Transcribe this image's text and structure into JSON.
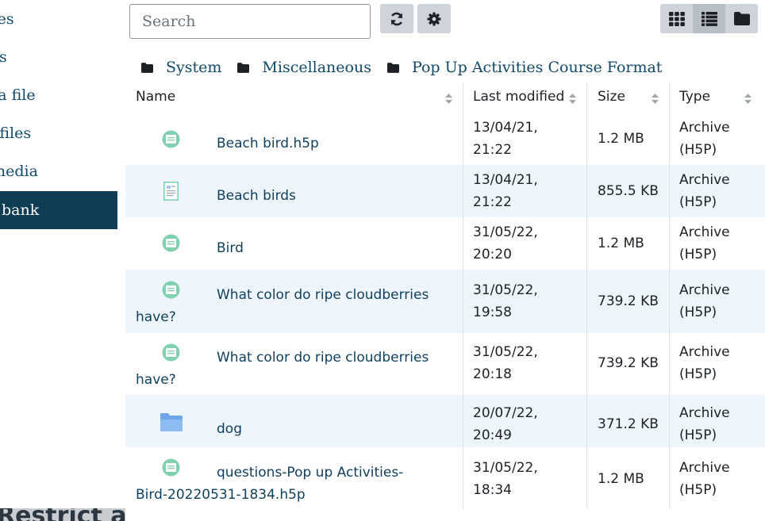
{
  "sidebar": {
    "items": [
      {
        "label": "Private files",
        "active": false
      },
      {
        "label": "Content files",
        "active": false
      },
      {
        "label": "Upload a file",
        "active": false
      },
      {
        "label": "Course files",
        "active": false
      },
      {
        "label": "Embedded media",
        "active": false
      },
      {
        "label": "Content bank",
        "active": true
      }
    ],
    "bottom_text": "Restrict ac"
  },
  "toolbar": {
    "search_placeholder": "Search",
    "refresh_icon": "refresh-icon",
    "settings_icon": "gear-icon",
    "view_icons": [
      "grid-icon",
      "list-icon",
      "folder-tree-icon"
    ],
    "active_view": "list"
  },
  "breadcrumb": [
    "System",
    "Miscellaneous",
    "Pop Up Activities Course Format"
  ],
  "table": {
    "columns": [
      "Name",
      "Last modified",
      "Size",
      "Type"
    ],
    "rows": [
      {
        "name_line1": "Beach bird.h5p",
        "name_line2": "",
        "date1": "13/04/21,",
        "date2": "21:22",
        "size": "1.2 MB",
        "type1": "Archive",
        "type2": "(H5P)",
        "icon": "h5p-file-icon"
      },
      {
        "name_line1": "Beach birds",
        "name_line2": "",
        "date1": "13/04/21,",
        "date2": "21:22",
        "size": "855.5 KB",
        "type1": "Archive",
        "type2": "(H5P)",
        "icon": "document-icon"
      },
      {
        "name_line1": "Bird",
        "name_line2": "",
        "date1": "31/05/22,",
        "date2": "20:20",
        "size": "1.2 MB",
        "type1": "Archive",
        "type2": "(H5P)",
        "icon": "h5p-file-icon"
      },
      {
        "name_line1": "What color do ripe cloudberries",
        "name_line2": "have?",
        "date1": "31/05/22,",
        "date2": "19:58",
        "size": "739.2 KB",
        "type1": "Archive",
        "type2": "(H5P)",
        "icon": "h5p-file-icon"
      },
      {
        "name_line1": "What color do ripe cloudberries",
        "name_line2": "have?",
        "date1": "31/05/22,",
        "date2": "20:18",
        "size": "739.2 KB",
        "type1": "Archive",
        "type2": "(H5P)",
        "icon": "h5p-file-icon"
      },
      {
        "name_line1": "dog",
        "name_line2": "",
        "date1": "20/07/22,",
        "date2": "20:49",
        "size": "371.2 KB",
        "type1": "Archive",
        "type2": "(H5P)",
        "icon": "folder-icon"
      },
      {
        "name_line1": "questions-Pop up Activities-",
        "name_line2": "Bird-20220531-1834.h5p",
        "date1": "31/05/22,",
        "date2": "18:34",
        "size": "1.2 MB",
        "type1": "Archive",
        "type2": "(H5P)",
        "icon": "h5p-file-icon"
      }
    ]
  },
  "colors": {
    "active_sidebar_bg": "#0f3d56",
    "link": "#0f4a6b",
    "row_alt_bg": "#eef5fc",
    "h5p_icon": "#7fd1b0"
  }
}
